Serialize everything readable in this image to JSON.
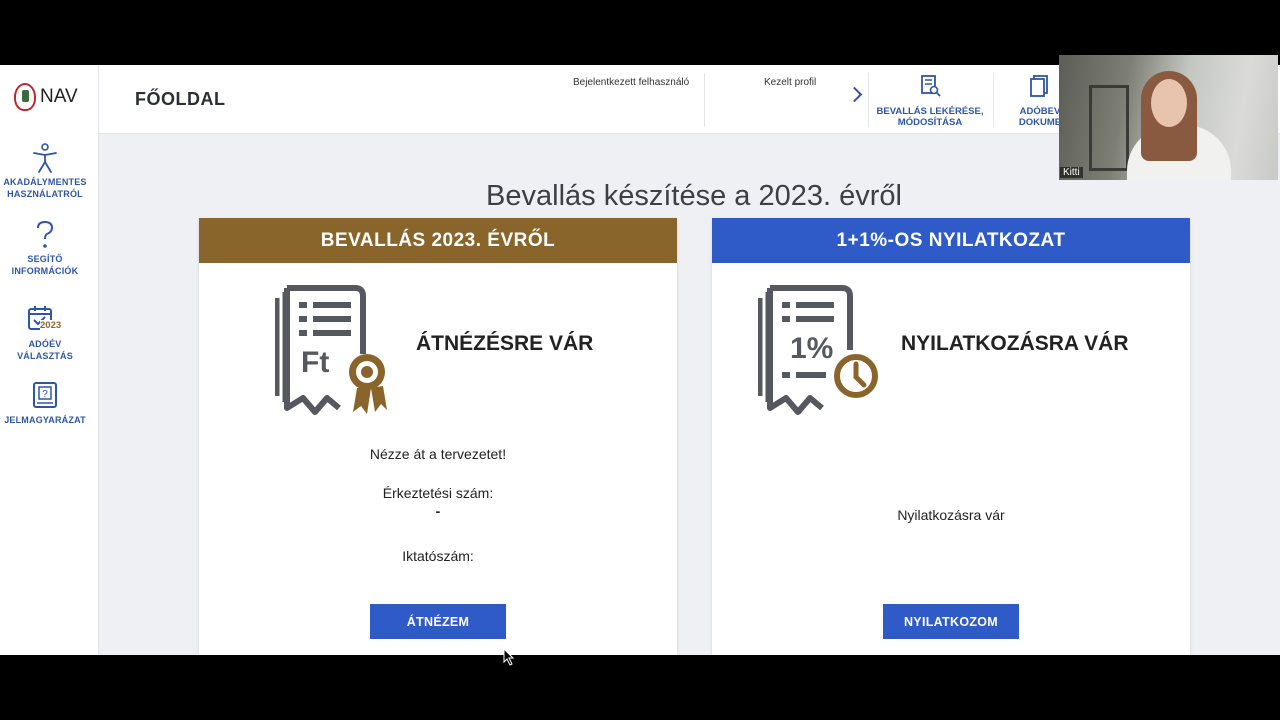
{
  "app": {
    "logo_text": "NAV"
  },
  "sidebar": {
    "items": [
      {
        "label": "AKADÁLYMENTES HASZNÁLATRÓL",
        "icon": "accessibility-icon"
      },
      {
        "label": "SEGÍTŐ INFORMÁCIÓK",
        "icon": "help-icon"
      },
      {
        "label": "ADÓÉV VÁLASZTÁS",
        "icon": "calendar-icon",
        "badge": "2023"
      },
      {
        "label": "JELMAGYARÁZAT",
        "icon": "legend-book-icon"
      }
    ]
  },
  "header": {
    "title": "FŐOLDAL",
    "logged_in_user_label": "Bejelentkezett felhasználó",
    "profile_label": "Kezelt profil",
    "actions": [
      {
        "label": "BEVALLÁS LEKÉRÉSE, MÓDOSÍTÁSA",
        "icon": "document-search-icon"
      },
      {
        "label": "ADÓBEV DOKUME",
        "icon": "documents-icon"
      }
    ]
  },
  "main": {
    "heading": "Bevallás készítése a 2023. évről",
    "cards": [
      {
        "title": "BEVALLÁS 2023. ÉVRŐL",
        "header_color": "#8a652b",
        "status": "ÁTNÉZÉSRE VÁR",
        "icon": "tax-return-forint-icon",
        "icon_text": "Ft",
        "text_main": "Nézze át a tervezetet!",
        "arrival_label": "Érkeztetési szám:",
        "arrival_value": "-",
        "filing_label": "Iktatószám:",
        "button": "ÁTNÉZEM"
      },
      {
        "title": "1+1%-OS NYILATKOZAT",
        "header_color": "#2f5bc8",
        "status": "NYILATKOZÁSRA VÁR",
        "icon": "one-percent-declaration-icon",
        "icon_text": "1%",
        "text_main": "Nyilatkozásra vár",
        "button": "NYILATKOZOM"
      }
    ]
  },
  "webcam": {
    "name": "Kitti"
  },
  "colors": {
    "accent_blue": "#2f5bc8",
    "gold": "#8a652b",
    "icon_gray": "#55595f"
  }
}
